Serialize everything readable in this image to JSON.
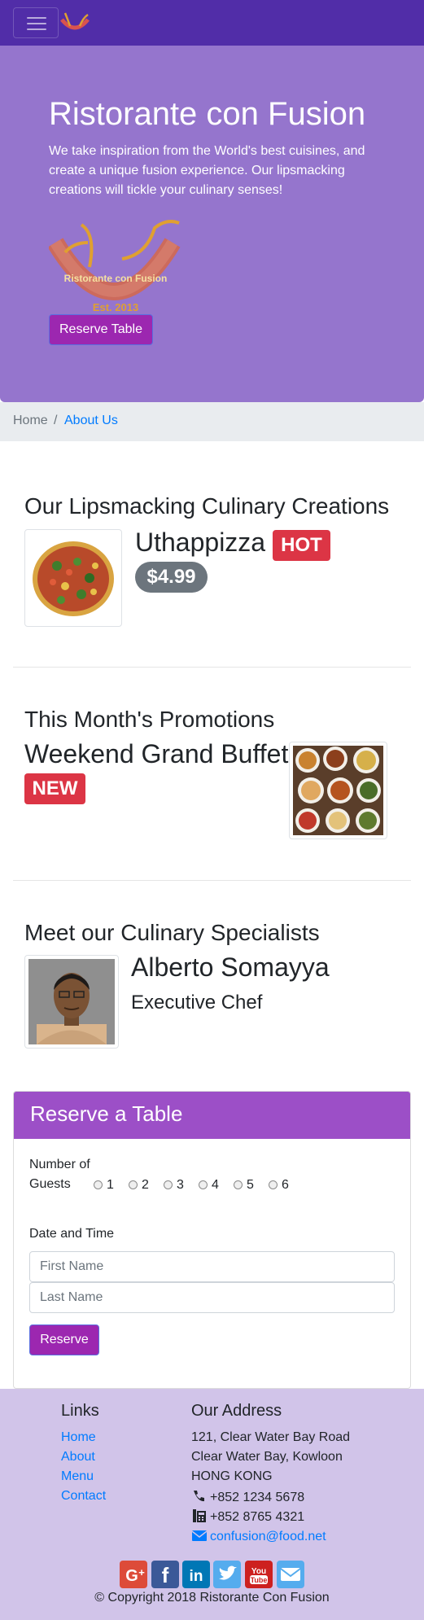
{
  "navbar": {
    "menu_icon": "hamburger-menu-icon",
    "logo": "restaurant-logo",
    "color": "#512da8"
  },
  "jumbotron": {
    "title": "Ristorante con Fusion",
    "text": "We take inspiration from the World's best cuisines, and create a unique fusion experience. Our lipsmacking creations will tickle your culinary senses!",
    "logo_text": "Ristorante con Fusion",
    "logo_est": "Est. 2013",
    "reserve_button": "Reserve Table",
    "color": "#9575cd"
  },
  "breadcrumb": {
    "home": "Home",
    "separator": "/",
    "current": "About Us"
  },
  "creations": {
    "heading": "Our Lipsmacking Culinary Creations",
    "dish_name": "Uthappizza",
    "badge": "HOT",
    "price": "$4.99",
    "image": "pizza-image"
  },
  "promotions": {
    "heading": "This Month's Promotions",
    "name": "Weekend Grand Buffet",
    "badge": "NEW",
    "image": "buffet-image"
  },
  "specialists": {
    "heading": "Meet our Culinary Specialists",
    "name": "Alberto Somayya",
    "role": "Executive Chef",
    "image": "chef-photo"
  },
  "reserve": {
    "heading": "Reserve a Table",
    "guests_label": "Number of Guests",
    "guest_options": [
      "1",
      "2",
      "3",
      "4",
      "5",
      "6"
    ],
    "datetime_label": "Date and Time",
    "first_name_placeholder": "First Name",
    "last_name_placeholder": "Last Name",
    "button": "Reserve",
    "header_color": "#9c4fc7"
  },
  "footer": {
    "links_heading": "Links",
    "links": [
      "Home",
      "About",
      "Menu",
      "Contact"
    ],
    "address_heading": "Our Address",
    "address_lines": [
      "121, Clear Water Bay Road",
      "Clear Water Bay, Kowloon",
      "HONG KONG"
    ],
    "phone": "+852 1234 5678",
    "fax": "+852 8765 4321",
    "email": "confusion@food.net",
    "social_icons": [
      "google-plus-icon",
      "facebook-icon",
      "linkedin-icon",
      "twitter-icon",
      "youtube-icon",
      "mail-icon"
    ],
    "copyright": "© Copyright 2018 Ristorante Con Fusion",
    "color": "#d1c4e9"
  }
}
